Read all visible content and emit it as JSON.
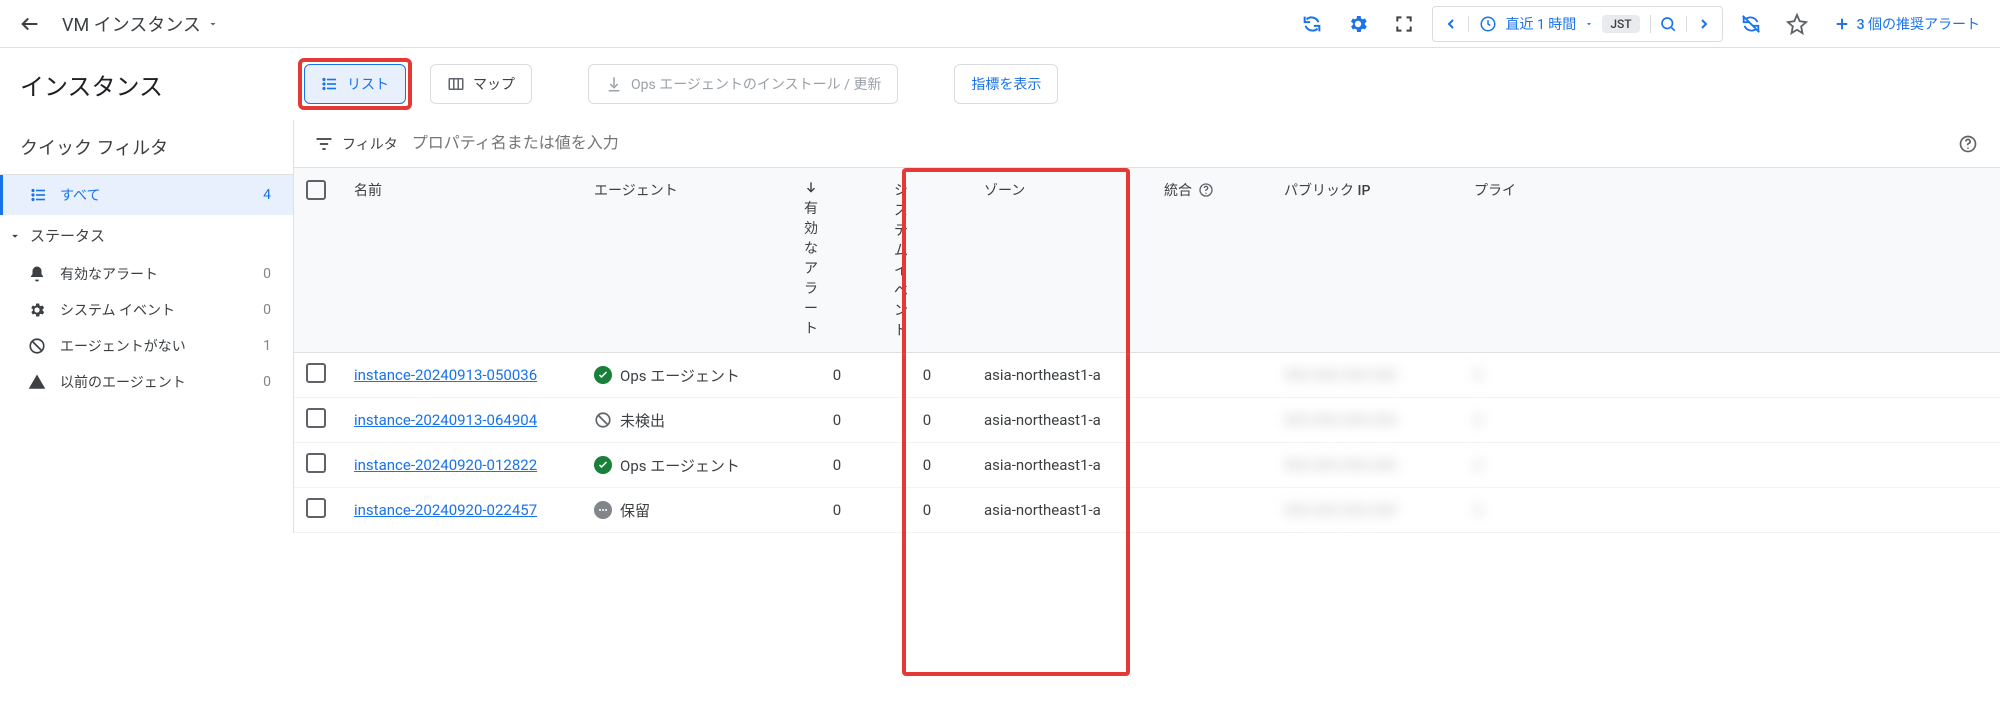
{
  "topbar": {
    "title": "VM インスタンス",
    "time_range": "直近 1 時間",
    "timezone": "JST",
    "alerts_link": "3 個の推奨アラート"
  },
  "secondbar": {
    "page_title": "インスタンス",
    "list_btn": "リスト",
    "map_btn": "マップ",
    "install_btn": "Ops エージェントのインストール / 更新",
    "metrics_btn": "指標を表示"
  },
  "sidebar": {
    "header": "クイック フィルタ",
    "all_label": "すべて",
    "all_count": "4",
    "status_label": "ステータス",
    "items": [
      {
        "icon": "bell",
        "label": "有効なアラート",
        "count": "0"
      },
      {
        "icon": "gear-event",
        "label": "システム イベント",
        "count": "0"
      },
      {
        "icon": "no-agent",
        "label": "エージェントがない",
        "count": "1"
      },
      {
        "icon": "warn",
        "label": "以前のエージェント",
        "count": "0"
      }
    ]
  },
  "filter": {
    "label": "フィルタ",
    "placeholder": "プロパティ名または値を入力"
  },
  "columns": {
    "name": "名前",
    "agent": "エージェント",
    "alerts": "有効なアラート",
    "sysevents": "システムイベント",
    "zone": "ゾーン",
    "integration": "統合",
    "public_ip": "パブリック IP",
    "private": "プライ"
  },
  "rows": [
    {
      "name": "instance-20240913-050036",
      "agent_status": "ok",
      "agent_text": "Ops エージェント",
      "alerts": "0",
      "sys": "0",
      "zone": "asia-northeast1-a"
    },
    {
      "name": "instance-20240913-064904",
      "agent_status": "none",
      "agent_text": "未検出",
      "alerts": "0",
      "sys": "0",
      "zone": "asia-northeast1-a"
    },
    {
      "name": "instance-20240920-012822",
      "agent_status": "ok",
      "agent_text": "Ops エージェント",
      "alerts": "0",
      "sys": "0",
      "zone": "asia-northeast1-a"
    },
    {
      "name": "instance-20240920-022457",
      "agent_status": "pending",
      "agent_text": "保留",
      "alerts": "0",
      "sys": "0",
      "zone": "asia-northeast1-a"
    }
  ]
}
